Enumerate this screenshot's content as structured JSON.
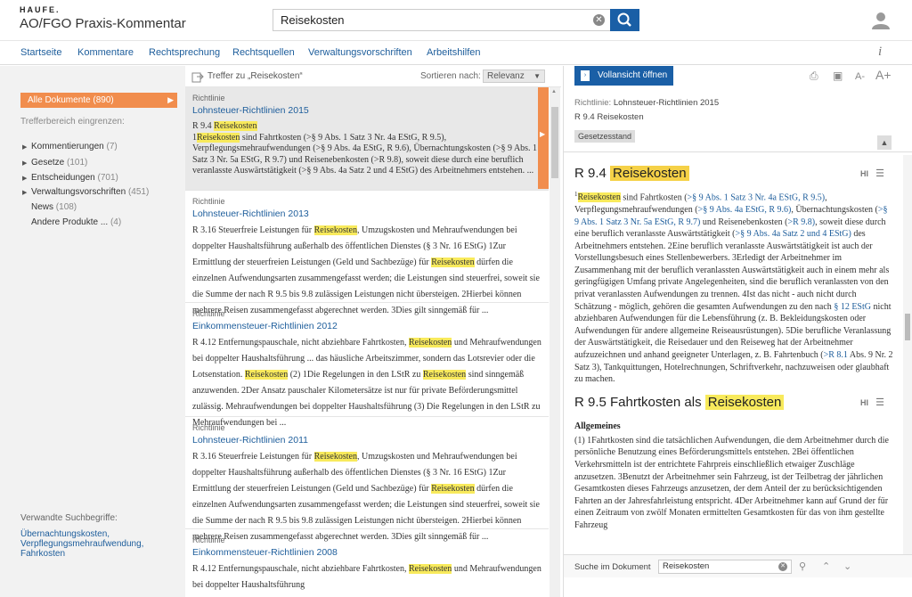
{
  "app": {
    "brand": "HAUFE.",
    "title": "AO/FGO Praxis-Kommentar"
  },
  "search": {
    "value": "Reisekosten"
  },
  "nav": [
    "Startseite",
    "Kommentare",
    "Rechtsprechung",
    "Rechtsquellen",
    "Verwaltungsvorschriften",
    "Arbeitshilfen"
  ],
  "sidebar": {
    "all_docs": "Alle Dokumente (890)",
    "narrow_label": "Trefferbereich eingrenzen:",
    "tree": [
      {
        "label": "Kommentierungen",
        "count": "(7)"
      },
      {
        "label": "Gesetze",
        "count": "(101)"
      },
      {
        "label": "Entscheidungen",
        "count": "(701)"
      },
      {
        "label": "Verwaltungsvorschriften",
        "count": "(451)"
      },
      {
        "label": "News",
        "count": "(108)"
      },
      {
        "label": "Andere Produkte ...",
        "count": "(4)"
      }
    ],
    "related_title": "Verwandte Suchbegriffe:",
    "related": [
      "Übernachtungskosten,",
      "Verpflegungsmehraufwendung,",
      "Fahrkosten"
    ]
  },
  "results_header": {
    "label": "Treffer zu „Reisekosten“",
    "sort_label": "Sortieren nach:",
    "sort_value": "Relevanz"
  },
  "results": [
    {
      "type": "Richtlinie",
      "title": "Lohnsteuer-Richtlinien 2015",
      "line1": "R 9.4 ",
      "hl1": "Reisekosten",
      "text": "1@Reisekosten@ sind Fahrtkosten (>§ 9 Abs. 1 Satz 3 Nr. 4a EStG, R 9.5), Verpflegungsmehraufwendungen (>§ 9 Abs. 4a EStG, R 9.6), Übernachtungskosten (>§ 9 Abs. 1 Satz 3 Nr. 5a EStG, R 9.7) und Reisenebenkosten (>R 9.8), soweit diese durch eine beruflich veranlasste Auswärtstätigkeit (>§ 9 Abs. 4a Satz 2 und 4 EStG) des Arbeitnehmers entstehen. ..."
    },
    {
      "type": "Richtlinie",
      "title": "Lohnsteuer-Richtlinien 2013",
      "text": "R 3.16 Steuerfreie Leistungen für @Reisekosten@, Umzugskosten und Mehraufwendungen bei doppelter Haushaltsführung außerhalb des öffentlichen Dienstes (§ 3 Nr. 16 EStG) 1Zur Ermittlung der steuerfreien Leistungen (Geld und Sachbezüge) für @Reisekosten@ dürfen die einzelnen Aufwendungsarten zusammengefasst werden; die Leistungen sind steuerfrei, soweit sie die Summe der nach R 9.5 bis 9.8 zulässigen Leistungen nicht übersteigen. 2Hierbei können mehrere Reisen zusammengefasst abgerechnet werden. 3Dies gilt sinngemäß für ..."
    },
    {
      "type": "Richtlinie",
      "title": "Einkommensteuer-Richtlinien 2012",
      "text": "R 4.12 Entfernungspauschale, nicht abziehbare Fahrtkosten, @Reisekosten@ und Mehraufwendungen bei doppelter Haushaltsführung ... das häusliche Arbeitszimmer, sondern das Lotsrevier oder die Lotsenstation. @Reisekosten@ (2) 1Die Regelungen in den LStR zu @Reisekosten@ sind sinngemäß anzuwenden. 2Der Ansatz pauschaler Kilometersätze ist nur für private Beförderungsmittel zulässig. Mehraufwendungen bei doppelter Haushaltsführung (3) Die Regelungen in den LStR zu Mehraufwendungen bei ..."
    },
    {
      "type": "Richtlinie",
      "title": "Lohnsteuer-Richtlinien 2011",
      "text": "R 3.16 Steuerfreie Leistungen für @Reisekosten@, Umzugskosten und Mehraufwendungen bei doppelter Haushaltsführung außerhalb des öffentlichen Dienstes (§ 3 Nr. 16 EStG) 1Zur Ermittlung der steuerfreien Leistungen (Geld und Sachbezüge) für @Reisekosten@ dürfen die einzelnen Aufwendungsarten zusammengefasst werden; die Leistungen sind steuerfrei, soweit sie die Summe der nach R 9.5 bis 9.8 zulässigen Leistungen nicht übersteigen. 2Hierbei können mehrere Reisen zusammengefasst abgerechnet werden. 3Dies gilt sinngemäß für ..."
    },
    {
      "type": "Richtlinie",
      "title": "Einkommensteuer-Richtlinien 2008",
      "text": "R 4.12 Entfernungspauschale, nicht abziehbare Fahrtkosten, @Reisekosten@ und Mehraufwendungen bei doppelter Haushaltsführung"
    }
  ],
  "document": {
    "fullview_label": "Vollansicht öffnen",
    "meta_label": "Richtlinie:",
    "meta_value": "Lohnsteuer-Richtlinien 2015",
    "meta_section": "R 9.4 Reisekosten",
    "tag": "Gesetzesstand",
    "h1_prefix": "R 9.4",
    "h1_hl": "Reisekosten",
    "p1": "Reisekosten sind Fahrtkosten (>§ 9 Abs. 1 Satz 3 Nr. 4a EStG, R 9.5), Verpflegungsmehraufwendungen (>§ 9 Abs. 4a EStG, R 9.6), Übernachtungskosten (>§ 9 Abs. 1 Satz 3 Nr. 5a EStG, R 9.7) und Reisenebenkosten (>R 9.8), soweit diese durch eine beruflich veranlasste Auswärtstätigkeit (>§ 9 Abs. 4a Satz 2 und 4 EStG) des Arbeitnehmers entstehen. 2Eine beruflich veranlasste Auswärtstätigkeit ist auch der Vorstellungsbesuch eines Stellenbewerbers. 3Erledigt der Arbeitnehmer im Zusammenhang mit der beruflich veranlassten Auswärtstätigkeit auch in einem mehr als geringfügigen Umfang private Angelegenheiten, sind die beruflich veranlassten von den privat veranlassten Aufwendungen zu trennen. 4Ist das nicht - auch nicht durch Schätzung - möglich, gehören die gesamten Aufwendungen zu den nach § 12 EStG nicht abziehbaren Aufwendungen für die Lebensführung (z. B. Bekleidungskosten oder Aufwendungen für andere allgemeine Reiseausrüstungen). 5Die berufliche Veranlassung der Auswärtstätigkeit, die Reisedauer und den Reiseweg hat der Arbeitnehmer aufzuzeichnen und anhand geeigneter Unterlagen, z. B. Fahrtenbuch (>R 8.1 Abs. 9 Nr. 2 Satz 3), Tankquittungen, Hotelrechnungen, Schriftverkehr, nachzuweisen oder glaubhaft zu machen.",
    "h2_prefix": "R 9.5 Fahrtkosten als",
    "h2_hl": "Reisekosten",
    "sub": "Allgemeines",
    "p2": "(1) 1Fahrtkosten sind die tatsächlichen Aufwendungen, die dem Arbeitnehmer durch die persönliche Benutzung eines Beförderungsmittels entstehen. 2Bei öffentlichen Verkehrsmitteln ist der entrichtete Fahrpreis einschließlich etwaiger Zuschläge anzusetzen. 3Benutzt der Arbeitnehmer sein Fahrzeug, ist der Teilbetrag der jährlichen Gesamtkosten dieses Fahrzeugs anzusetzen, der dem Anteil der zu berücksichtigenden Fahrten an der Jahresfahrleistung entspricht. 4Der Arbeitnehmer kann auf Grund der für einen Zeitraum von zwölf Monaten ermittelten Gesamtkosten für das von ihm gestellte Fahrzeug",
    "search_label": "Suche im Dokument",
    "search_value": "Reisekosten"
  },
  "colors": {
    "accent": "#1a5fa6",
    "orange": "#f18d4d",
    "highlight": "#f8ea5c"
  }
}
